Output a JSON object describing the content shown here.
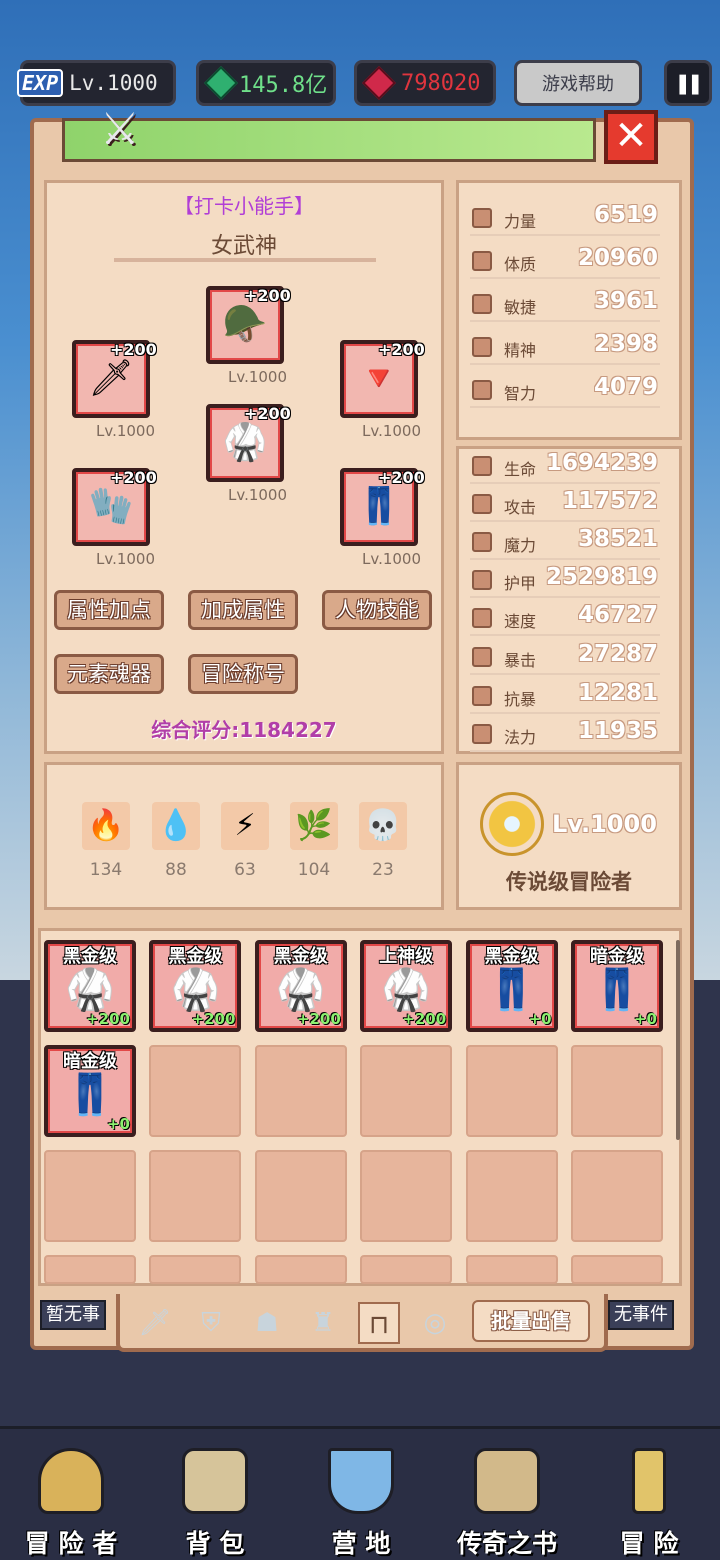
{
  "hud": {
    "exp_label": "EXP",
    "level": "Lv.1000",
    "emerald": "145.8亿",
    "ruby": "798020",
    "help_label": "游戏帮助",
    "pause_icon": "pause-icon"
  },
  "window": {
    "close_symbol": "✕"
  },
  "character": {
    "title_tag": "【打卡小能手】",
    "class_name": "女武神",
    "equipment": [
      {
        "slot": "head",
        "plus": "+200",
        "level": "Lv.1000",
        "icon": "🪖"
      },
      {
        "slot": "weapon",
        "plus": "+200",
        "level": "Lv.1000",
        "icon": "🗡"
      },
      {
        "slot": "amulet",
        "plus": "+200",
        "level": "Lv.1000",
        "icon": "🔻"
      },
      {
        "slot": "armor",
        "plus": "+200",
        "level": "Lv.1000",
        "icon": "🥋"
      },
      {
        "slot": "gloves",
        "plus": "+200",
        "level": "Lv.1000",
        "icon": "🧤"
      },
      {
        "slot": "legs",
        "plus": "+200",
        "level": "Lv.1000",
        "icon": "👖"
      }
    ],
    "buttons": [
      "属性加点",
      "加成属性",
      "人物技能",
      "元素魂器",
      "冒险称号"
    ],
    "score_label": "综合评分:1184227"
  },
  "base_stats": [
    {
      "label": "力量",
      "value": "6519"
    },
    {
      "label": "体质",
      "value": "20960"
    },
    {
      "label": "敏捷",
      "value": "3961"
    },
    {
      "label": "精神",
      "value": "2398"
    },
    {
      "label": "智力",
      "value": "4079"
    }
  ],
  "combat_stats": [
    {
      "label": "生命",
      "value": "1694239"
    },
    {
      "label": "攻击",
      "value": "117572"
    },
    {
      "label": "魔力",
      "value": "38521"
    },
    {
      "label": "护甲",
      "value": "2529819"
    },
    {
      "label": "速度",
      "value": "46727"
    },
    {
      "label": "暴击",
      "value": "27287"
    },
    {
      "label": "抗暴",
      "value": "12281"
    },
    {
      "label": "法力",
      "value": "11935"
    }
  ],
  "elements": [
    {
      "name": "fire",
      "icon": "🔥",
      "value": "134"
    },
    {
      "name": "water",
      "icon": "💧",
      "value": "88"
    },
    {
      "name": "lightning",
      "icon": "⚡",
      "value": "63"
    },
    {
      "name": "earth",
      "icon": "🌿",
      "value": "104"
    },
    {
      "name": "dark",
      "icon": "💀",
      "value": "23"
    }
  ],
  "rank": {
    "level": "Lv.1000",
    "title": "传说级冒险者"
  },
  "inventory": [
    {
      "grade": "黑金级",
      "plus": "+200",
      "icon": "🥋"
    },
    {
      "grade": "黑金级",
      "plus": "+200",
      "icon": "🥋"
    },
    {
      "grade": "黑金级",
      "plus": "+200",
      "icon": "🥋"
    },
    {
      "grade": "上神级",
      "plus": "+200",
      "icon": "🥋"
    },
    {
      "grade": "黑金级",
      "plus": "+0",
      "icon": "👖"
    },
    {
      "grade": "暗金级",
      "plus": "+0",
      "icon": "👖"
    },
    {
      "grade": "暗金级",
      "plus": "+0",
      "icon": "👖"
    }
  ],
  "bottom_tabs": {
    "sell_label": "批量出售",
    "left_event": "暂无事",
    "right_event": "无事件"
  },
  "nav": [
    "冒 险 者",
    "背  包",
    "营  地",
    "传奇之书",
    "冒  险"
  ],
  "colors": {
    "frame": "#e9c8aa",
    "accent_green": "#8fd36b",
    "close_red": "#e53a2e",
    "score_purple": "#b13ea8"
  }
}
